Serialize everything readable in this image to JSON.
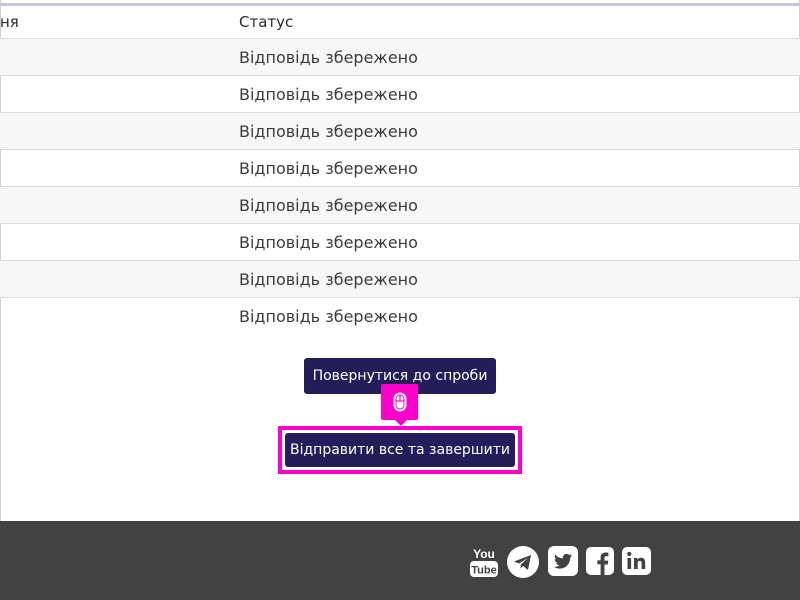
{
  "table": {
    "header": {
      "col1": "ня",
      "col2": "Статус"
    },
    "rows": [
      {
        "status": "Відповідь збережено"
      },
      {
        "status": "Відповідь збережено"
      },
      {
        "status": "Відповідь збережено"
      },
      {
        "status": "Відповідь збережено"
      },
      {
        "status": "Відповідь збережено"
      },
      {
        "status": "Відповідь збережено"
      },
      {
        "status": "Відповідь збережено"
      },
      {
        "status": "Відповідь збережено"
      }
    ]
  },
  "actions": {
    "return_label": "Повернутися до спроби",
    "submit_label": "Відправити все та завершити"
  },
  "footer": {
    "social": {
      "youtube_icon": "youtube-icon",
      "telegram_icon": "telegram-icon",
      "twitter_icon": "twitter-icon",
      "facebook_icon": "facebook-icon",
      "linkedin_icon": "linkedin-icon",
      "youtube_text_top": "You",
      "youtube_text_bottom": "Tube"
    }
  },
  "colors": {
    "button": "#231e5a",
    "highlight": "#ff00cc",
    "footer": "#424242"
  }
}
